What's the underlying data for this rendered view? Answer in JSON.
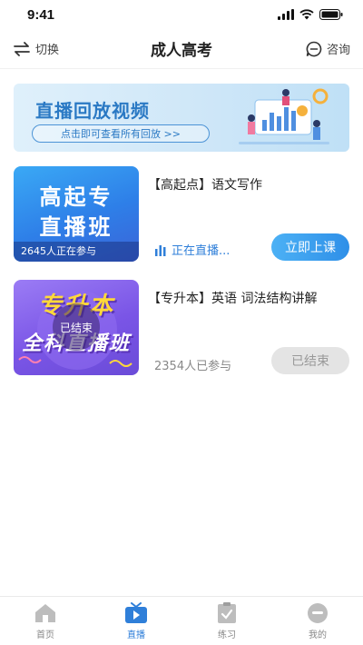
{
  "status_bar": {
    "time": "9:41"
  },
  "nav": {
    "switch_label": "切换",
    "title": "成人高考",
    "consult_label": "咨询"
  },
  "banner": {
    "title": "直播回放视频",
    "subtitle": "点击即可查看所有回放 >>"
  },
  "courses": [
    {
      "thumb_line1": "高起专",
      "thumb_line2": "直播班",
      "thumb_count": "2645人正在参与",
      "title": "【高起点】语文写作",
      "status": "正在直播...",
      "action": "立即上课"
    },
    {
      "thumb_line1": "专升本",
      "thumb_line2": "全科直播班",
      "overlay": "已结束",
      "title": "【专升本】英语  词法结构讲解",
      "joined": "2354人已参与",
      "action": "已结束"
    }
  ],
  "tabs": [
    {
      "label": "首页",
      "icon": "home-icon"
    },
    {
      "label": "直播",
      "icon": "tv-icon"
    },
    {
      "label": "练习",
      "icon": "exercise-icon"
    },
    {
      "label": "我的",
      "icon": "profile-icon"
    }
  ],
  "colors": {
    "accent": "#2f7fd9",
    "button_gradient": [
      "#4cb1f5",
      "#2e8fe8"
    ],
    "ended_button": "#e4e4e4"
  }
}
